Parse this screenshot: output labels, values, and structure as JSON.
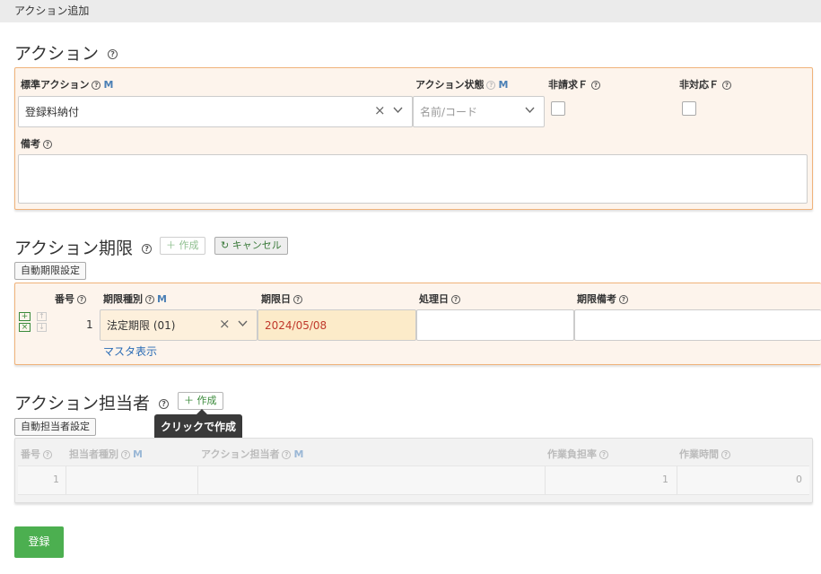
{
  "window": {
    "title": "アクション追加"
  },
  "action_section": {
    "title": "アクション",
    "standard_action": {
      "label": "標準アクション",
      "marker": "M",
      "value": "登録料納付"
    },
    "action_status": {
      "label": "アクション状態",
      "marker": "M",
      "placeholder": "名前/コード"
    },
    "non_billing": {
      "label": "非請求Ｆ"
    },
    "non_response": {
      "label": "非対応Ｆ"
    },
    "remarks": {
      "label": "備考"
    }
  },
  "deadline_section": {
    "title": "アクション期限",
    "create_label": "作成",
    "cancel_label": "キャンセル",
    "auto_label": "自動期限設定",
    "columns": [
      "番号",
      "期限種別",
      "期限日",
      "処理日",
      "期限備考"
    ],
    "deadline_type_marker": "M",
    "rows": [
      {
        "number": "1",
        "type": "法定期限 (01)",
        "due_date": "2024/05/08",
        "processed_date": "",
        "remarks": ""
      }
    ],
    "master_link": "マスタ表示"
  },
  "assignee_section": {
    "title": "アクション担当者",
    "create_label": "作成",
    "tooltip": "クリックで作成",
    "auto_label": "自動担当者設定",
    "columns": [
      "番号",
      "担当者種別",
      "アクション担当者",
      "作業負担率",
      "作業時間"
    ],
    "column_markers": [
      "",
      "M",
      "M",
      "",
      ""
    ],
    "rows": [
      {
        "number": "1",
        "type": "",
        "assignee": "",
        "load_rate": "1",
        "work_time": "0"
      }
    ]
  },
  "submit_label": "登録",
  "icons": {
    "help": "help-circle-icon",
    "clear": "clear-x-icon",
    "dropdown": "chevron-down-icon",
    "plus": "plus-icon",
    "refresh": "refresh-icon"
  },
  "colors": {
    "panel_border": "#f0b37a",
    "panel_bg": "#fdf4ec",
    "due_date_bg": "#fcebc9",
    "due_date_text": "#c0392b",
    "submit_bg": "#4caf50",
    "tooltip_bg": "#3a3a3a"
  }
}
